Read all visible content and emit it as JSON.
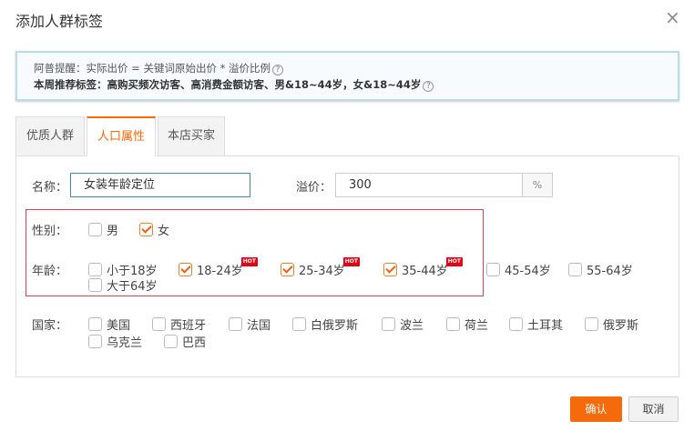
{
  "dialog": {
    "title": "添加人群标签",
    "close": "×"
  },
  "notice": {
    "line1": "阿普提醒：实际出价 = 关键词原始出价 * 溢价比例",
    "line2": "本周推荐标签：高购买频次访客、高消费金额访客、男&18~44岁，女&18~44岁",
    "help": "?"
  },
  "tabs": [
    "优质人群",
    "人口属性",
    "本店买家"
  ],
  "form": {
    "name_label": "名称：",
    "name_value": "女装年龄定位",
    "premium_label": "溢价：",
    "premium_value": "300",
    "premium_unit": "%"
  },
  "gender": {
    "label": "性别：",
    "options": [
      {
        "label": "男",
        "checked": false
      },
      {
        "label": "女",
        "checked": true
      }
    ]
  },
  "age": {
    "label": "年龄：",
    "hot": "HOT",
    "options": [
      "小于18岁",
      "18-24岁",
      "25-34岁",
      "35-44岁",
      "45-54岁",
      "55-64岁",
      "大于64岁"
    ],
    "checked": [
      false,
      true,
      true,
      true,
      false,
      false,
      false
    ]
  },
  "country": {
    "label": "国家：",
    "options": [
      "美国",
      "西班牙",
      "法国",
      "白俄罗斯",
      "波兰",
      "荷兰",
      "土耳其",
      "俄罗斯",
      "乌克兰",
      "巴西"
    ]
  },
  "buttons": {
    "confirm": "确认",
    "cancel": "取消"
  }
}
